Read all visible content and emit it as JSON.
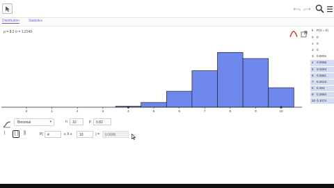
{
  "toolbar": {
    "undo_icon": "undo-icon",
    "redo_icon": "redo-icon",
    "search_icon": "search-icon",
    "menu_icon": "menu-icon"
  },
  "tabs": [
    {
      "label": "Distribution",
      "active": true
    },
    {
      "label": "Statistics",
      "active": false
    }
  ],
  "stats_text": "μ = 8.2   σ = 1.2149",
  "chart_data": {
    "type": "bar",
    "categories": [
      "0",
      "1",
      "2",
      "3",
      "4",
      "5",
      "6",
      "7",
      "8",
      "9",
      "10"
    ],
    "values": [
      0,
      0,
      0,
      0.0004,
      0.0055,
      0.0264,
      0.0881,
      0.2013,
      0.302,
      0.2684,
      0.1074
    ],
    "ylim": [
      0,
      0.33
    ],
    "highlight_x": 10,
    "bar_color": "#6f88ee"
  },
  "table": {
    "headers": [
      "k",
      "P(X = k)"
    ],
    "rows": [
      {
        "x": "0",
        "p": "0",
        "hl": false
      },
      {
        "x": "1",
        "p": "0",
        "hl": false
      },
      {
        "x": "2",
        "p": "0",
        "hl": false
      },
      {
        "x": "3",
        "p": "0.0004",
        "hl": false
      },
      {
        "x": "4",
        "p": "0.0055",
        "hl": true
      },
      {
        "x": "5",
        "p": "0.0264",
        "hl": true
      },
      {
        "x": "6",
        "p": "0.0881",
        "hl": true
      },
      {
        "x": "7",
        "p": "0.2013",
        "hl": true
      },
      {
        "x": "8",
        "p": "0.302",
        "hl": true
      },
      {
        "x": "9",
        "p": "0.2684",
        "hl": true
      },
      {
        "x": "10",
        "p": "0.1074",
        "hl": true
      }
    ]
  },
  "controls": {
    "distribution": "Binomial",
    "n_label": "n",
    "n_value": "10",
    "p_label": "p",
    "p_value": "0.82",
    "prob_label": "P(",
    "lower_value": "4",
    "le_x_le": "≤ X ≤",
    "upper_value": "10",
    "equals_label": ") =",
    "result_value": "0.9996",
    "mode_buttons": [
      "|",
      "[ ]",
      "]|"
    ]
  }
}
